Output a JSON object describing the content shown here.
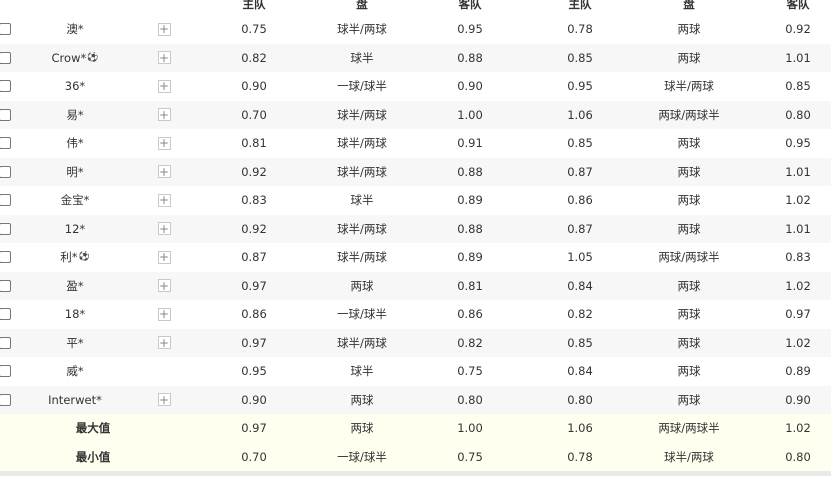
{
  "headers": {
    "home1": "主队",
    "line1": "盘",
    "away1": "客队",
    "home2": "主队",
    "line2": "盘",
    "away2": "客队"
  },
  "rows": [
    {
      "company": "澳*",
      "ball": false,
      "plus": true,
      "h1": "0.75",
      "p1": "球半/两球",
      "a1": "0.95",
      "h2": "0.78",
      "p2": "两球",
      "a2": "0.92"
    },
    {
      "company": "Crow*",
      "ball": true,
      "plus": true,
      "h1": "0.82",
      "p1": "球半",
      "a1": "0.88",
      "h2": "0.85",
      "p2": "两球",
      "a2": "1.01"
    },
    {
      "company": "36*",
      "ball": false,
      "plus": true,
      "h1": "0.90",
      "p1": "一球/球半",
      "a1": "0.90",
      "h2": "0.95",
      "p2": "球半/两球",
      "a2": "0.85"
    },
    {
      "company": "易*",
      "ball": false,
      "plus": true,
      "h1": "0.70",
      "p1": "球半/两球",
      "a1": "1.00",
      "h2": "1.06",
      "p2": "两球/两球半",
      "a2": "0.80"
    },
    {
      "company": "伟*",
      "ball": false,
      "plus": true,
      "h1": "0.81",
      "p1": "球半/两球",
      "a1": "0.91",
      "h2": "0.85",
      "p2": "两球",
      "a2": "0.95"
    },
    {
      "company": "明*",
      "ball": false,
      "plus": true,
      "h1": "0.92",
      "p1": "球半/两球",
      "a1": "0.88",
      "h2": "0.87",
      "p2": "两球",
      "a2": "1.01"
    },
    {
      "company": "金宝*",
      "ball": false,
      "plus": true,
      "h1": "0.83",
      "p1": "球半",
      "a1": "0.89",
      "h2": "0.86",
      "p2": "两球",
      "a2": "1.02"
    },
    {
      "company": "12*",
      "ball": false,
      "plus": true,
      "h1": "0.92",
      "p1": "球半/两球",
      "a1": "0.88",
      "h2": "0.87",
      "p2": "两球",
      "a2": "1.01"
    },
    {
      "company": "利*",
      "ball": true,
      "plus": true,
      "h1": "0.87",
      "p1": "球半/两球",
      "a1": "0.89",
      "h2": "1.05",
      "p2": "两球/两球半",
      "a2": "0.83"
    },
    {
      "company": "盈*",
      "ball": false,
      "plus": true,
      "h1": "0.97",
      "p1": "两球",
      "a1": "0.81",
      "h2": "0.84",
      "p2": "两球",
      "a2": "1.02"
    },
    {
      "company": "18*",
      "ball": false,
      "plus": true,
      "h1": "0.86",
      "p1": "一球/球半",
      "a1": "0.86",
      "h2": "0.82",
      "p2": "两球",
      "a2": "0.97"
    },
    {
      "company": "平*",
      "ball": false,
      "plus": true,
      "h1": "0.97",
      "p1": "球半/两球",
      "a1": "0.82",
      "h2": "0.85",
      "p2": "两球",
      "a2": "1.02"
    },
    {
      "company": "威*",
      "ball": false,
      "plus": false,
      "h1": "0.95",
      "p1": "球半",
      "a1": "0.75",
      "h2": "0.84",
      "p2": "两球",
      "a2": "0.89"
    },
    {
      "company": "Interwet*",
      "ball": false,
      "plus": true,
      "h1": "0.90",
      "p1": "两球",
      "a1": "0.80",
      "h2": "0.80",
      "p2": "两球",
      "a2": "0.90"
    }
  ],
  "stats": [
    {
      "label": "最大值",
      "h1": "0.97",
      "p1": "两球",
      "a1": "1.00",
      "h2": "1.06",
      "p2": "两球/两球半",
      "a2": "1.02"
    },
    {
      "label": "最小值",
      "h1": "0.70",
      "p1": "一球/球半",
      "a1": "0.75",
      "h2": "0.78",
      "p2": "球半/两球",
      "a2": "0.80"
    }
  ],
  "icons": {
    "plus": "plus-icon",
    "ball": "soccer-ball-icon",
    "plus_glyph": "+",
    "ball_glyph": "⚽"
  }
}
